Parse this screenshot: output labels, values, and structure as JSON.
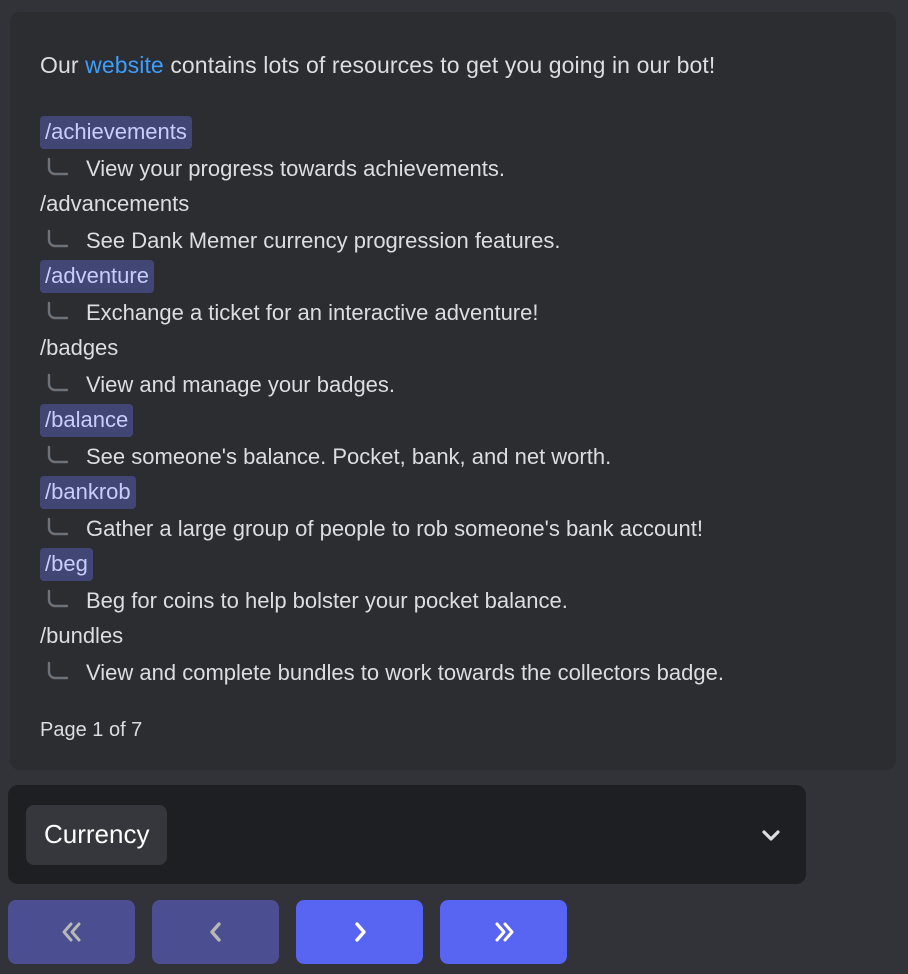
{
  "embed": {
    "intro": {
      "before": "Our ",
      "link_text": "website",
      "after": " contains lots of resources to get you going in our bot!"
    },
    "commands": [
      {
        "name": "/achievements",
        "highlighted": true,
        "description": "View your progress towards achievements."
      },
      {
        "name": "/advancements",
        "highlighted": false,
        "description": "See Dank Memer currency progression features."
      },
      {
        "name": "/adventure",
        "highlighted": true,
        "description": "Exchange a ticket for an interactive adventure!"
      },
      {
        "name": "/badges",
        "highlighted": false,
        "description": "View and manage your badges."
      },
      {
        "name": "/balance",
        "highlighted": true,
        "description": "See someone's balance. Pocket, bank, and net worth."
      },
      {
        "name": "/bankrob",
        "highlighted": true,
        "description": "Gather a large group of people to rob someone's bank account!"
      },
      {
        "name": "/beg",
        "highlighted": true,
        "description": "Beg for coins to help bolster your pocket balance."
      },
      {
        "name": "/bundles",
        "highlighted": false,
        "description": "View and complete bundles to work towards the collectors badge."
      }
    ],
    "page_indicator": "Page 1 of 7"
  },
  "category_select": {
    "selected_label": "Currency",
    "chevron_icon": "chevron-down-icon"
  },
  "pagination": {
    "buttons": [
      {
        "icon": "double-chevron-left-icon",
        "label": "«",
        "enabled": false,
        "name": "first-page-button"
      },
      {
        "icon": "chevron-left-icon",
        "label": "‹",
        "enabled": false,
        "name": "previous-page-button"
      },
      {
        "icon": "chevron-right-icon",
        "label": "›",
        "enabled": true,
        "name": "next-page-button"
      },
      {
        "icon": "double-chevron-right-icon",
        "label": "»",
        "enabled": true,
        "name": "last-page-button"
      }
    ]
  },
  "colors": {
    "embed_background": "#2b2d31",
    "page_background": "#313338",
    "select_background": "#1e1f22",
    "mention_pill_background": "#414675",
    "mention_pill_text": "#c9cdfb",
    "link": "#3c9eff",
    "blurple_active": "#5865f2",
    "blurple_disabled": "#4b4e90",
    "body_text": "#dbdee1"
  }
}
